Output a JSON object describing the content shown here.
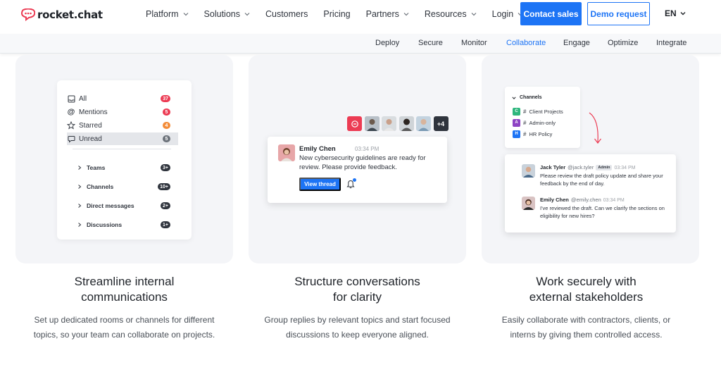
{
  "brand": {
    "name": "rocket.chat",
    "color": "#ec3b53",
    "accent": "#1d74f5"
  },
  "nav": {
    "links": [
      {
        "label": "Platform",
        "dropdown": true
      },
      {
        "label": "Solutions",
        "dropdown": true
      },
      {
        "label": "Customers",
        "dropdown": false
      },
      {
        "label": "Pricing",
        "dropdown": false
      },
      {
        "label": "Partners",
        "dropdown": true
      },
      {
        "label": "Resources",
        "dropdown": true
      },
      {
        "label": "Login",
        "dropdown": true
      }
    ],
    "contact_label": "Contact sales",
    "demo_label": "Demo request",
    "lang": "EN"
  },
  "subnav": {
    "items": [
      "Deploy",
      "Secure",
      "Monitor",
      "Collaborate",
      "Engage",
      "Optimize",
      "Integrate"
    ],
    "active": "Collaborate"
  },
  "card1": {
    "filters": [
      {
        "label": "All",
        "count": "37",
        "color": "#ec3b53",
        "icon": "inbox-icon"
      },
      {
        "label": "Mentions",
        "count": "5",
        "color": "#ec3b53",
        "icon": "at-icon"
      },
      {
        "label": "Starred",
        "count": "4",
        "color": "#f38c39",
        "icon": "star-icon"
      },
      {
        "label": "Unread",
        "count": "5",
        "color": "#6c727a",
        "icon": "chat-icon"
      }
    ],
    "groups": [
      {
        "label": "Teams",
        "count": "3+"
      },
      {
        "label": "Channels",
        "count": "10+"
      },
      {
        "label": "Direct messages",
        "count": "2+"
      },
      {
        "label": "Discussions",
        "count": "1+"
      }
    ]
  },
  "card2": {
    "more_count": "+4",
    "message": {
      "name": "Emily Chen",
      "time": "03:34 PM",
      "text": "New cybersecurity guidelines are ready for review. Please provide feedback.",
      "button": "View thread"
    }
  },
  "card3": {
    "channels_header": "Channels",
    "channels": [
      {
        "letter": "C",
        "name": "Client Projects",
        "color": "#2eb67d"
      },
      {
        "letter": "A",
        "name": "Admin-only",
        "color": "#8e44c4"
      },
      {
        "letter": "H",
        "name": "HR Policy",
        "color": "#1d74f5"
      }
    ],
    "messages": [
      {
        "name": "Jack Tyler",
        "handle": "@jack.tyler",
        "tag": "Admin",
        "time": "03:34 PM",
        "text": "Please review the draft policy update and share your feedback by the end of day."
      },
      {
        "name": "Emily Chen",
        "handle": "@emily.chen",
        "tag": "",
        "time": "03:34 PM",
        "text": "I've reviewed the draft. Can we clarify the sections on eligibility for new hires?"
      }
    ]
  },
  "features": [
    {
      "title_line1": "Streamline internal",
      "title_line2": "communications",
      "desc_line1": "Set up dedicated rooms or channels for different",
      "desc_line2": "topics, so your team can collaborate on projects."
    },
    {
      "title_line1": "Structure conversations",
      "title_line2": "for clarity",
      "desc_line1": "Group replies by relevant topics and start focused",
      "desc_line2": "discussions to keep everyone aligned."
    },
    {
      "title_line1": "Work securely with",
      "title_line2": "external stakeholders",
      "desc_line1": "Easily collaborate with contractors, clients, or",
      "desc_line2": "interns by giving them controlled access."
    }
  ]
}
